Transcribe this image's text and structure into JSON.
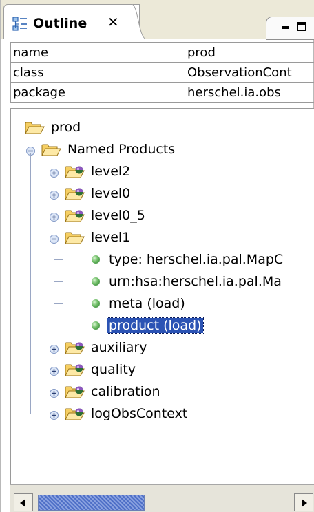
{
  "panel": {
    "title": "Outline",
    "close_glyph": "✕",
    "icon": "outline-view-icon",
    "window_controls": [
      "minimize-icon",
      "maximize-icon"
    ]
  },
  "properties": [
    {
      "key": "name",
      "value": "prod"
    },
    {
      "key": "class",
      "value": "ObservationCont"
    },
    {
      "key": "package",
      "value": "herschel.ia.obs"
    }
  ],
  "tree": [
    {
      "label": "prod",
      "icon": "folder-open-icon"
    },
    {
      "label": "Named Products",
      "icon": "folder-open-icon",
      "expanded": true
    },
    {
      "label": "level2",
      "icon": "product-folder-icon",
      "expanded": false
    },
    {
      "label": "level0",
      "icon": "product-folder-icon",
      "expanded": false
    },
    {
      "label": "level0_5",
      "icon": "product-folder-icon",
      "expanded": false
    },
    {
      "label": "level1",
      "icon": "folder-open-icon",
      "expanded": true
    },
    {
      "label": "type: herschel.ia.pal.MapC",
      "icon": "leaf-dot-icon"
    },
    {
      "label": "urn:hsa:herschel.ia.pal.Ma",
      "icon": "leaf-dot-icon"
    },
    {
      "label": "meta (load)",
      "icon": "leaf-dot-icon"
    },
    {
      "label": "product (load)",
      "icon": "leaf-dot-icon",
      "selected": true
    },
    {
      "label": "auxiliary",
      "icon": "product-folder-icon",
      "expanded": false
    },
    {
      "label": "quality",
      "icon": "product-folder-icon",
      "expanded": false
    },
    {
      "label": "calibration",
      "icon": "product-folder-icon",
      "expanded": false
    },
    {
      "label": "logObsContext",
      "icon": "product-folder-icon",
      "expanded": false
    }
  ],
  "colors": {
    "selection": "#2b53b4",
    "tree_lines": "#9aa7c4",
    "leaf": "#4caf50",
    "folder": "#f2b840",
    "scroll_thumb": "#4e6fc7"
  }
}
